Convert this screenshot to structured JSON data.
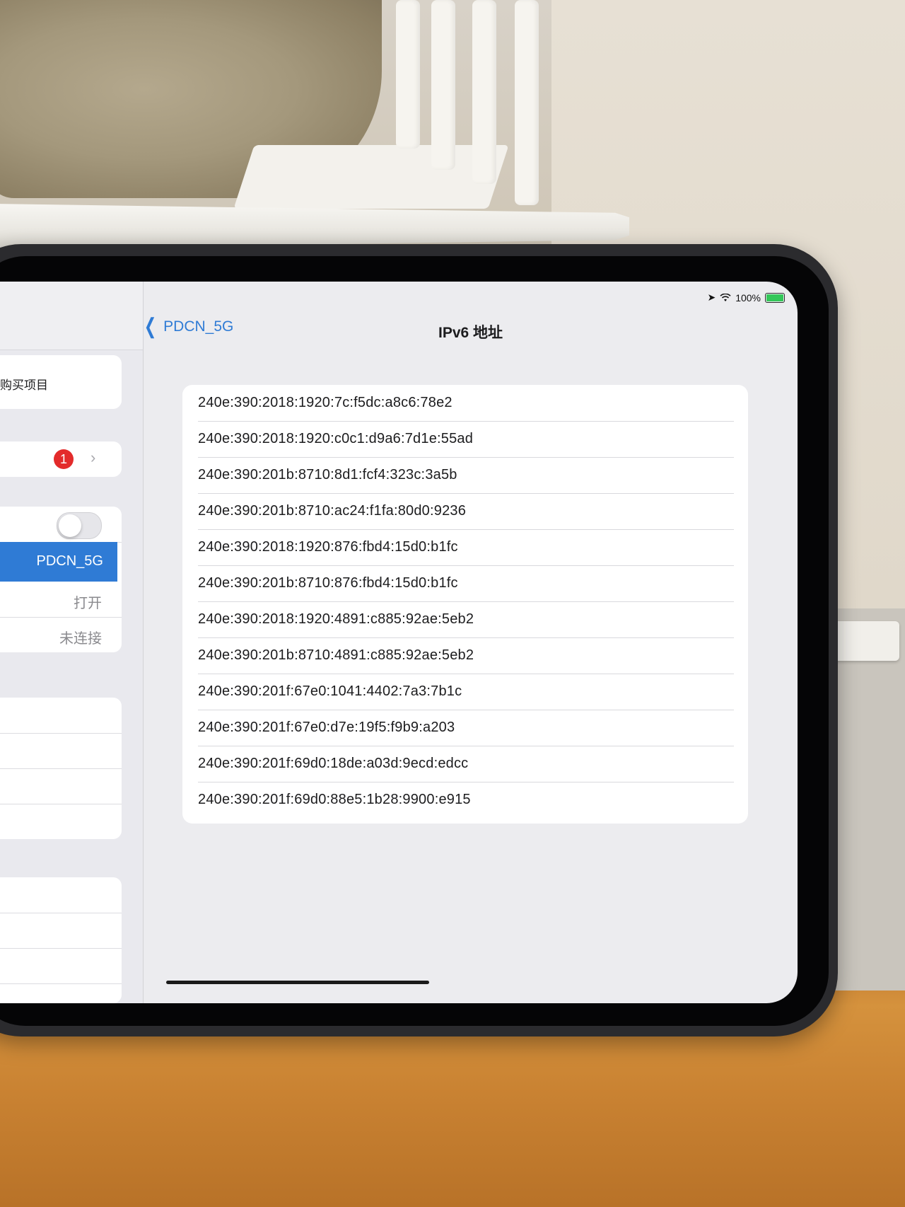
{
  "status_bar": {
    "location_icon": "location-arrow-icon",
    "wifi_icon": "wifi-icon",
    "battery_percent": "100%",
    "battery_level": 1.0
  },
  "sidebar": {
    "purchase_text": "购买项目",
    "badge_count": "1",
    "toggle_on": false,
    "selected_network": "PDCN_5G",
    "row_open_value": "打开",
    "row_status_value": "未连接"
  },
  "nav": {
    "back_label": "PDCN_5G",
    "title": "IPv6 地址"
  },
  "addresses": [
    "240e:390:2018:1920:7c:f5dc:a8c6:78e2",
    "240e:390:2018:1920:c0c1:d9a6:7d1e:55ad",
    "240e:390:201b:8710:8d1:fcf4:323c:3a5b",
    "240e:390:201b:8710:ac24:f1fa:80d0:9236",
    "240e:390:2018:1920:876:fbd4:15d0:b1fc",
    "240e:390:201b:8710:876:fbd4:15d0:b1fc",
    "240e:390:2018:1920:4891:c885:92ae:5eb2",
    "240e:390:201b:8710:4891:c885:92ae:5eb2",
    "240e:390:201f:67e0:1041:4402:7a3:7b1c",
    "240e:390:201f:67e0:d7e:19f5:f9b9:a203",
    "240e:390:201f:69d0:18de:a03d:9ecd:edcc",
    "240e:390:201f:69d0:88e5:1b28:9900:e915"
  ],
  "colors": {
    "accent": "#2f7bd5",
    "badge": "#e32b2b",
    "battery": "#33c759"
  }
}
